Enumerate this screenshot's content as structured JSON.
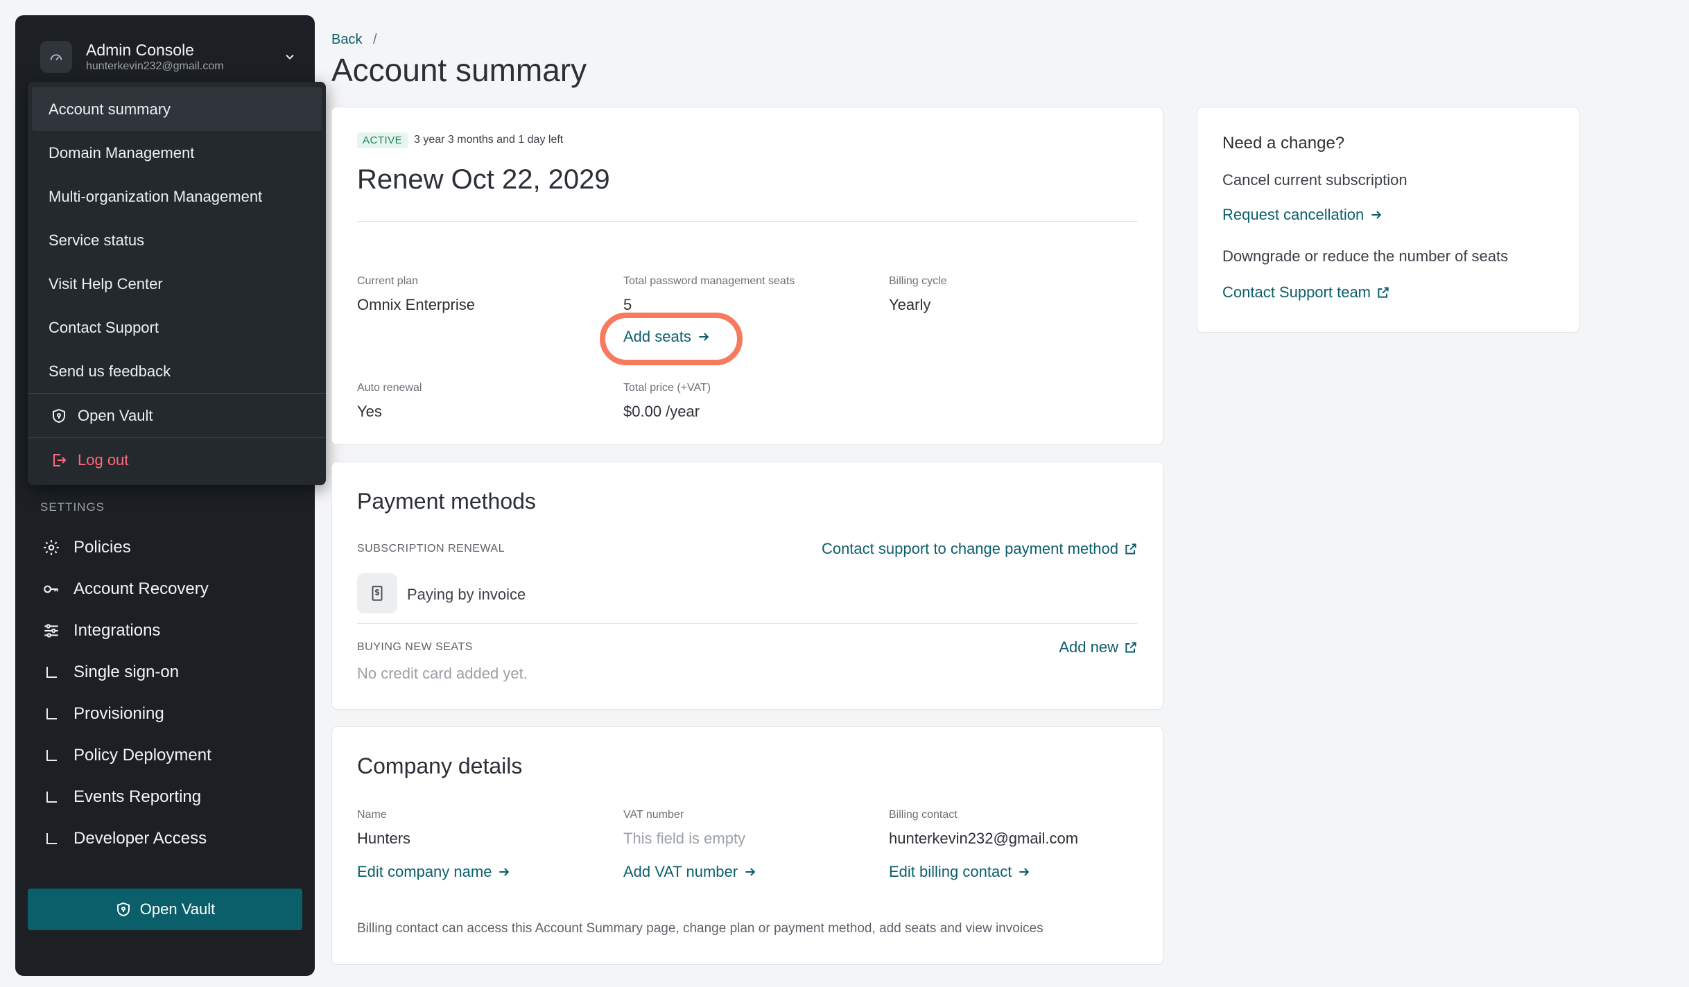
{
  "sidebar": {
    "console_title": "Admin Console",
    "console_email": "hunterkevin232@gmail.com",
    "settings_label": "SETTINGS",
    "nav": [
      {
        "label": "Policies",
        "icon": "gear-icon"
      },
      {
        "label": "Account Recovery",
        "icon": "key-icon"
      },
      {
        "label": "Integrations",
        "icon": "sliders-icon"
      },
      {
        "label": "Single sign-on",
        "icon": "subitem-icon"
      },
      {
        "label": "Provisioning",
        "icon": "subitem-icon"
      },
      {
        "label": "Policy Deployment",
        "icon": "subitem-icon"
      },
      {
        "label": "Events Reporting",
        "icon": "subitem-icon"
      },
      {
        "label": "Developer Access",
        "icon": "subitem-icon"
      }
    ],
    "vault_button": "Open Vault"
  },
  "dropdown": {
    "items": [
      "Account summary",
      "Domain Management",
      "Multi-organization Management",
      "Service status",
      "Visit Help Center",
      "Contact Support",
      "Send us feedback"
    ],
    "open_vault": "Open Vault",
    "log_out": "Log out",
    "logout_color": "#ff6b78"
  },
  "header": {
    "breadcrumb_back": "Back",
    "breadcrumb_sep": "/",
    "title": "Account summary"
  },
  "summary": {
    "badge": "ACTIVE",
    "time_left": "3 year 3 months and 1 day left",
    "renew": "Renew Oct 22, 2029",
    "current_plan_label": "Current plan",
    "current_plan": "Omnix Enterprise",
    "seats_label": "Total password management seats",
    "seats": "5",
    "add_seats": "Add seats",
    "billing_cycle_label": "Billing cycle",
    "billing_cycle": "Yearly",
    "auto_renewal_label": "Auto renewal",
    "auto_renewal": "Yes",
    "total_price_label": "Total price (+VAT)",
    "total_price": "$0.00 /year"
  },
  "payment": {
    "title": "Payment methods",
    "subscription_renewal": "SUBSCRIPTION RENEWAL",
    "contact_support_link": "Contact support to change payment method",
    "paying_by": "Paying by invoice",
    "buying_new_seats": "BUYING NEW SEATS",
    "add_new": "Add new",
    "no_card": "No credit card added yet."
  },
  "company": {
    "title": "Company details",
    "name_label": "Name",
    "name": "Hunters",
    "edit_name": "Edit company name",
    "vat_label": "VAT number",
    "vat": "This field is empty",
    "add_vat": "Add VAT number",
    "billing_contact_label": "Billing contact",
    "billing_contact": "hunterkevin232@gmail.com",
    "edit_billing": "Edit billing contact",
    "footnote": "Billing contact can access this Account Summary page, change plan or payment method, add seats and view invoices"
  },
  "side": {
    "title": "Need a change?",
    "cancel_text": "Cancel current subscription",
    "request_cancellation": "Request cancellation",
    "downgrade_text": "Downgrade or reduce the number of seats",
    "contact_support_team": "Contact Support team"
  },
  "colors": {
    "accent": "#0b5f6b",
    "highlight": "#f77a5e",
    "sidebar_bg": "#1c2024"
  }
}
